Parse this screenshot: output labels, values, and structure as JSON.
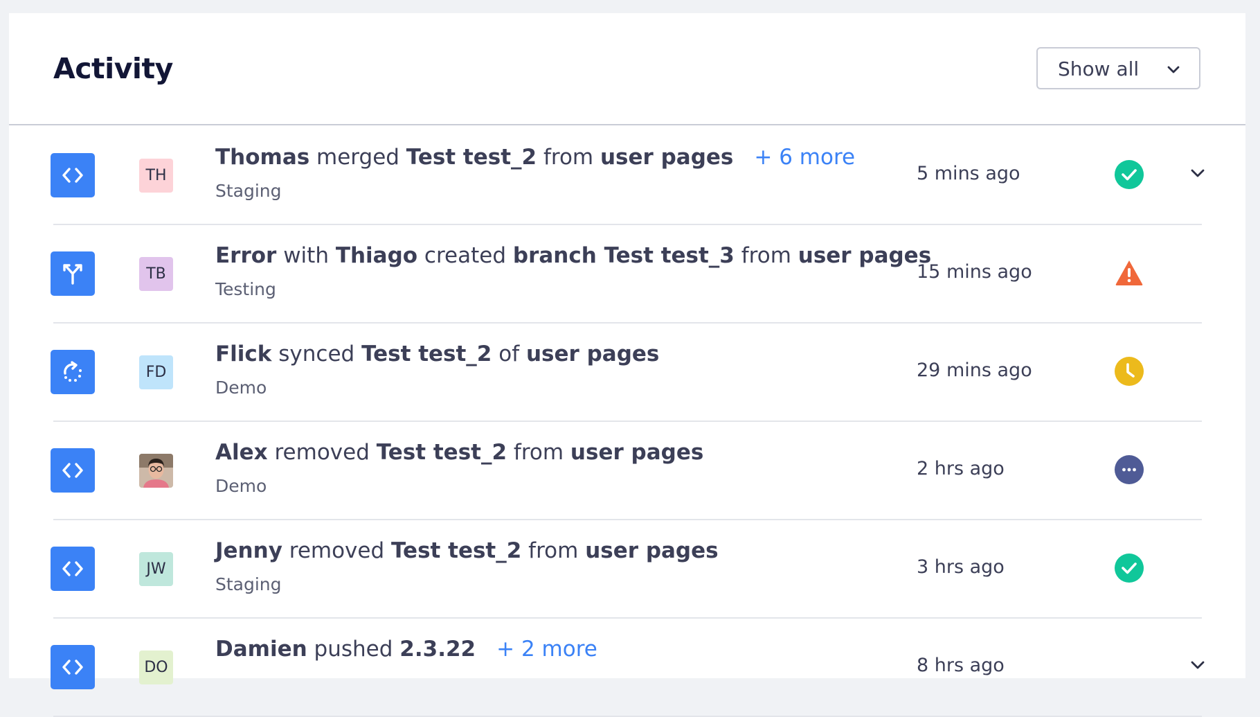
{
  "header": {
    "title": "Activity",
    "filter": {
      "selected": "Show all"
    }
  },
  "colors": {
    "accent": "#3b82f6",
    "success": "#10c79a",
    "warning": "#f0683a",
    "pending": "#ecba1c",
    "neutral": "#4f5b96"
  },
  "activities": [
    {
      "type_icon": "code-icon",
      "avatar": {
        "initials": "TH",
        "bg": "#fdd3d8"
      },
      "actor": "Thomas",
      "text": [
        {
          "t": "Thomas",
          "b": true
        },
        {
          "t": " merged ",
          "b": false
        },
        {
          "t": "Test test_2",
          "b": true
        },
        {
          "t": " from ",
          "b": false
        },
        {
          "t": "user pages",
          "b": true
        }
      ],
      "more": "+ 6 more",
      "environment": "Staging",
      "time": "5 mins ago",
      "status": "success",
      "expandable": true
    },
    {
      "type_icon": "branch-icon",
      "avatar": {
        "initials": "TB",
        "bg": "#e1c4ec"
      },
      "text": [
        {
          "t": "Error",
          "b": true
        },
        {
          "t": " with ",
          "b": false
        },
        {
          "t": "Thiago",
          "b": true
        },
        {
          "t": " created ",
          "b": false
        },
        {
          "t": "branch Test test_3",
          "b": true
        },
        {
          "t": " from ",
          "b": false
        },
        {
          "t": "user pages",
          "b": true
        }
      ],
      "more": "",
      "environment": "Testing",
      "time": "15 mins ago",
      "status": "warning",
      "expandable": false
    },
    {
      "type_icon": "sync-icon",
      "avatar": {
        "initials": "FD",
        "bg": "#bfe4fb"
      },
      "text": [
        {
          "t": "Flick",
          "b": true
        },
        {
          "t": " synced ",
          "b": false
        },
        {
          "t": "Test test_2",
          "b": true
        },
        {
          "t": " of ",
          "b": false
        },
        {
          "t": "user pages",
          "b": true
        }
      ],
      "more": "",
      "environment": "Demo",
      "time": "29 mins ago",
      "status": "pending",
      "expandable": false
    },
    {
      "type_icon": "code-icon",
      "avatar": {
        "initials": "",
        "bg": "#d9c6b8",
        "photo": true
      },
      "text": [
        {
          "t": "Alex",
          "b": true
        },
        {
          "t": " removed ",
          "b": false
        },
        {
          "t": "Test test_2",
          "b": true
        },
        {
          "t": " from ",
          "b": false
        },
        {
          "t": "user pages",
          "b": true
        }
      ],
      "more": "",
      "environment": "Demo",
      "time": "2 hrs ago",
      "status": "neutral",
      "expandable": false
    },
    {
      "type_icon": "code-icon",
      "avatar": {
        "initials": "JW",
        "bg": "#bfe7dc"
      },
      "text": [
        {
          "t": "Jenny",
          "b": true
        },
        {
          "t": " removed ",
          "b": false
        },
        {
          "t": "Test test_2",
          "b": true
        },
        {
          "t": " from ",
          "b": false
        },
        {
          "t": "user pages",
          "b": true
        }
      ],
      "more": "",
      "environment": "Staging",
      "time": "3 hrs ago",
      "status": "success",
      "expandable": false
    },
    {
      "type_icon": "code-icon",
      "avatar": {
        "initials": "DO",
        "bg": "#e3f1cf"
      },
      "text": [
        {
          "t": "Damien",
          "b": true
        },
        {
          "t": " pushed ",
          "b": false
        },
        {
          "t": "2.3.22",
          "b": true
        }
      ],
      "more": "+ 2 more",
      "environment": "",
      "time": "8 hrs ago",
      "status": "",
      "expandable": true
    }
  ]
}
